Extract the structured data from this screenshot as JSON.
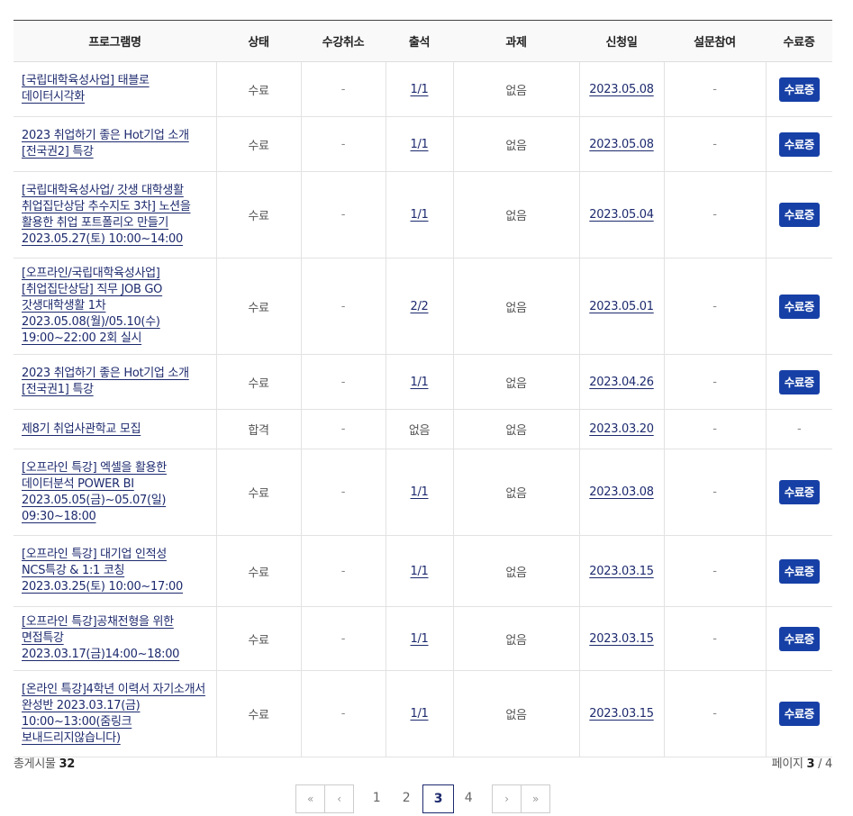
{
  "table": {
    "headers": [
      "프로그램명",
      "상태",
      "수강취소",
      "출석",
      "과제",
      "신청일",
      "설문참여",
      "수료증"
    ],
    "rows": [
      {
        "title": "[국립대학육성사업] 태블로 데이터시각화",
        "status": "수료",
        "cancel": "-",
        "attendance": "1/1",
        "assignment": "없음",
        "date": "2023.05.08",
        "survey": "-",
        "cert": "수료증"
      },
      {
        "title": "2023 취업하기 좋은 Hot기업 소개[전국권2] 특강",
        "status": "수료",
        "cancel": "-",
        "attendance": "1/1",
        "assignment": "없음",
        "date": "2023.05.08",
        "survey": "-",
        "cert": "수료증"
      },
      {
        "title": "[국립대학육성사업/ 갓생 대학생활 취업집단상담 추수지도 3차] 노션을 활용한 취업 포트폴리오 만들기 2023.05.27(토) 10:00~14:00",
        "status": "수료",
        "cancel": "-",
        "attendance": "1/1",
        "assignment": "없음",
        "date": "2023.05.04",
        "survey": "-",
        "cert": "수료증"
      },
      {
        "title": "[오프라인/국립대학육성사업][취업집단상담] 직무 JOB GO 갓생대학생활 1차 2023.05.08(월)/05.10(수) 19:00~22:00 2회 실시",
        "status": "수료",
        "cancel": "-",
        "attendance": "2/2",
        "assignment": "없음",
        "date": "2023.05.01",
        "survey": "-",
        "cert": "수료증"
      },
      {
        "title": "2023 취업하기 좋은 Hot기업 소개[전국권1] 특강",
        "status": "수료",
        "cancel": "-",
        "attendance": "1/1",
        "assignment": "없음",
        "date": "2023.04.26",
        "survey": "-",
        "cert": "수료증"
      },
      {
        "title": "제8기 취업사관학교 모집",
        "status": "합격",
        "cancel": "-",
        "attendance": "없음",
        "assignment": "없음",
        "date": "2023.03.20",
        "survey": "-",
        "cert": "-"
      },
      {
        "title": "[오프라인 특강] 엑셀을 활용한 데이터분석 POWER BI 2023.05.05(금)~05.07(일) 09:30~18:00",
        "status": "수료",
        "cancel": "-",
        "attendance": "1/1",
        "assignment": "없음",
        "date": "2023.03.08",
        "survey": "-",
        "cert": "수료증"
      },
      {
        "title": "[오프라인 특강] 대기업 인적성 NCS특강 & 1:1 코칭 2023.03.25(토) 10:00~17:00",
        "status": "수료",
        "cancel": "-",
        "attendance": "1/1",
        "assignment": "없음",
        "date": "2023.03.15",
        "survey": "-",
        "cert": "수료증"
      },
      {
        "title": "[오프라인 특강]공채전형을 위한 면접특강 2023.03.17(금)14:00~18:00",
        "status": "수료",
        "cancel": "-",
        "attendance": "1/1",
        "assignment": "없음",
        "date": "2023.03.15",
        "survey": "-",
        "cert": "수료증"
      },
      {
        "title": "[온라인 특강]4학년 이력서 자기소개서 완성반 2023.03.17(금) 10:00~13:00(줌링크 보내드리지않습니다)",
        "status": "수료",
        "cancel": "-",
        "attendance": "1/1",
        "assignment": "없음",
        "date": "2023.03.15",
        "survey": "-",
        "cert": "수료증"
      }
    ]
  },
  "summary": {
    "total_label": "총게시물",
    "total_count": "32",
    "page_label": "페이지",
    "current_page": "3",
    "page_sep": "/",
    "total_pages": "4"
  },
  "pagination": {
    "first": "«",
    "prev": "‹",
    "pages": [
      "1",
      "2",
      "3",
      "4"
    ],
    "active": "3",
    "next": "›",
    "last": "»"
  },
  "colors": {
    "accent": "#1740a6",
    "link": "#1d2a6e"
  }
}
